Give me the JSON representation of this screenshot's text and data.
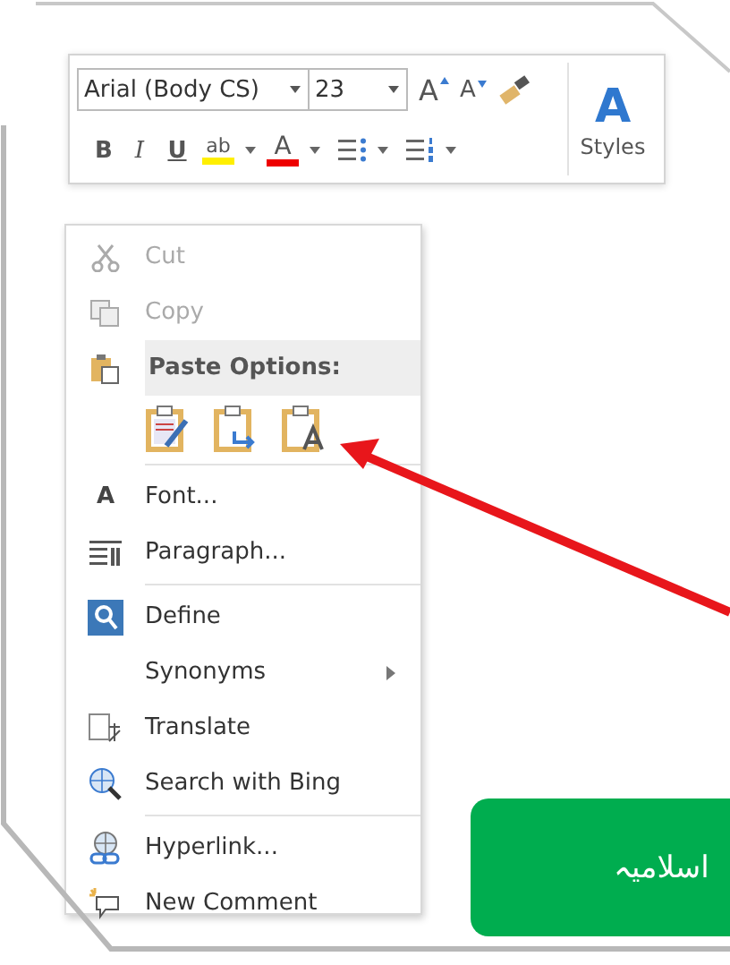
{
  "mini_toolbar": {
    "font_name": "Arial (Body CS)",
    "font_size": "23",
    "grow_font": "A",
    "shrink_font": "A",
    "bold": "B",
    "italic": "I",
    "underline": "U",
    "highlight": "ab",
    "font_color": "A",
    "styles_glyph": "A",
    "styles_label": "Styles"
  },
  "context_menu": {
    "items": [
      {
        "kind": "item",
        "label": "Cut",
        "disabled": true,
        "submenu": false
      },
      {
        "kind": "item",
        "label": "Copy",
        "disabled": true,
        "submenu": false
      },
      {
        "kind": "header",
        "label": "Paste Options:"
      },
      {
        "kind": "paste_row"
      },
      {
        "kind": "separator"
      },
      {
        "kind": "item",
        "glyph": "A",
        "label": "Font...",
        "disabled": false,
        "submenu": false
      },
      {
        "kind": "item",
        "label": "Paragraph...",
        "disabled": false,
        "submenu": false
      },
      {
        "kind": "separator"
      },
      {
        "kind": "item",
        "label": "Define",
        "disabled": false,
        "submenu": false
      },
      {
        "kind": "item",
        "label": "Synonyms",
        "disabled": false,
        "submenu": true
      },
      {
        "kind": "item",
        "label": "Translate",
        "disabled": false,
        "submenu": false
      },
      {
        "kind": "item",
        "label": "Search with Bing",
        "disabled": false,
        "submenu": false
      },
      {
        "kind": "separator"
      },
      {
        "kind": "item",
        "label": "Hyperlink...",
        "disabled": false,
        "submenu": false
      },
      {
        "kind": "item",
        "label": "New Comment",
        "disabled": false,
        "submenu": false
      }
    ]
  },
  "banner": {
    "text": "اسلامیہ"
  }
}
